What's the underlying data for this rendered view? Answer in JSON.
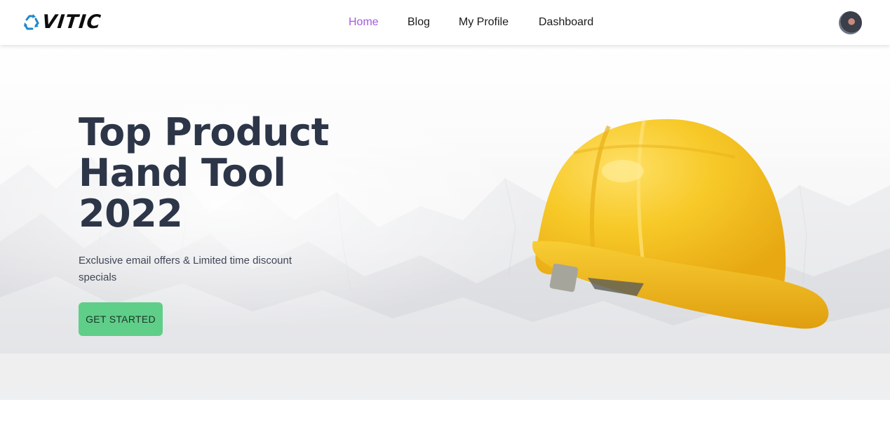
{
  "header": {
    "logo_text": "VITIC",
    "logo_icon": "recycle-icon",
    "nav": [
      {
        "label": "Home",
        "active": true
      },
      {
        "label": "Blog",
        "active": false
      },
      {
        "label": "My Profile",
        "active": false
      },
      {
        "label": "Dashboard",
        "active": false
      }
    ],
    "avatar_icon": "user-avatar"
  },
  "hero": {
    "title_lines": [
      "Top Product",
      "Hand Tool",
      "2022"
    ],
    "subtitle": "Exclusive email offers & Limited time discount specials",
    "cta_label": "GET STARTED",
    "image": "yellow-hard-hat"
  },
  "colors": {
    "nav_active": "#a35be0",
    "heading": "#2d3648",
    "cta_bg": "#5fce89",
    "logo_blue": "#1e88c8",
    "helmet_yellow": "#f5c426"
  }
}
